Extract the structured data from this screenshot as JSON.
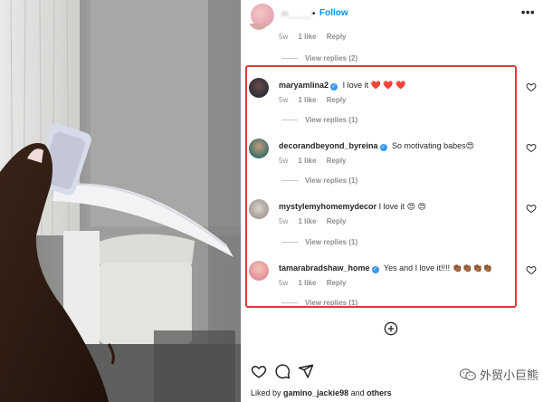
{
  "header": {
    "username": "m____r",
    "follow_label": "Follow",
    "more_icon": "more-horizontal-icon",
    "separator": "•"
  },
  "top_comment": {
    "time": "5w",
    "likes": "1 like",
    "reply_label": "Reply",
    "view_replies": "View replies (2)"
  },
  "comments": [
    {
      "username": "maryamlina2",
      "verified": true,
      "text": "I love it ❤️ ❤️ ❤️",
      "time": "5w",
      "likes": "1 like",
      "reply_label": "Reply",
      "view_replies": "View replies (1)"
    },
    {
      "username": "decorandbeyond_byreina",
      "verified": true,
      "text": "So motivating babes😍",
      "time": "5w",
      "likes": "1 like",
      "reply_label": "Reply",
      "view_replies": "View replies (1)"
    },
    {
      "username": "mystylemyhomemydecor",
      "verified": false,
      "text": "I love it 😍 😍",
      "time": "5w",
      "likes": "1 like",
      "reply_label": "Reply",
      "view_replies": "View replies (1)"
    },
    {
      "username": "tamarabradshaw_home",
      "verified": true,
      "text": "Yes and I love it!!!! 👏🏾👏🏾👏🏾👏🏾",
      "time": "5w",
      "likes": "1 like",
      "reply_label": "Reply",
      "view_replies": "View replies (1)"
    }
  ],
  "actions": {
    "like_icon": "heart-icon",
    "comment_icon": "comment-icon",
    "share_icon": "send-icon",
    "add_icon": "add-circle-icon"
  },
  "liked_by": {
    "prefix": "Liked by",
    "user": "gamino_jackie98",
    "suffix": "and",
    "others": "others"
  },
  "watermark": {
    "text": "外贸小巨熊",
    "icon": "wechat-icon"
  },
  "colors": {
    "highlight_box": "#e03a3a",
    "follow_blue": "#0095f6",
    "verified_blue": "#3897f0"
  }
}
